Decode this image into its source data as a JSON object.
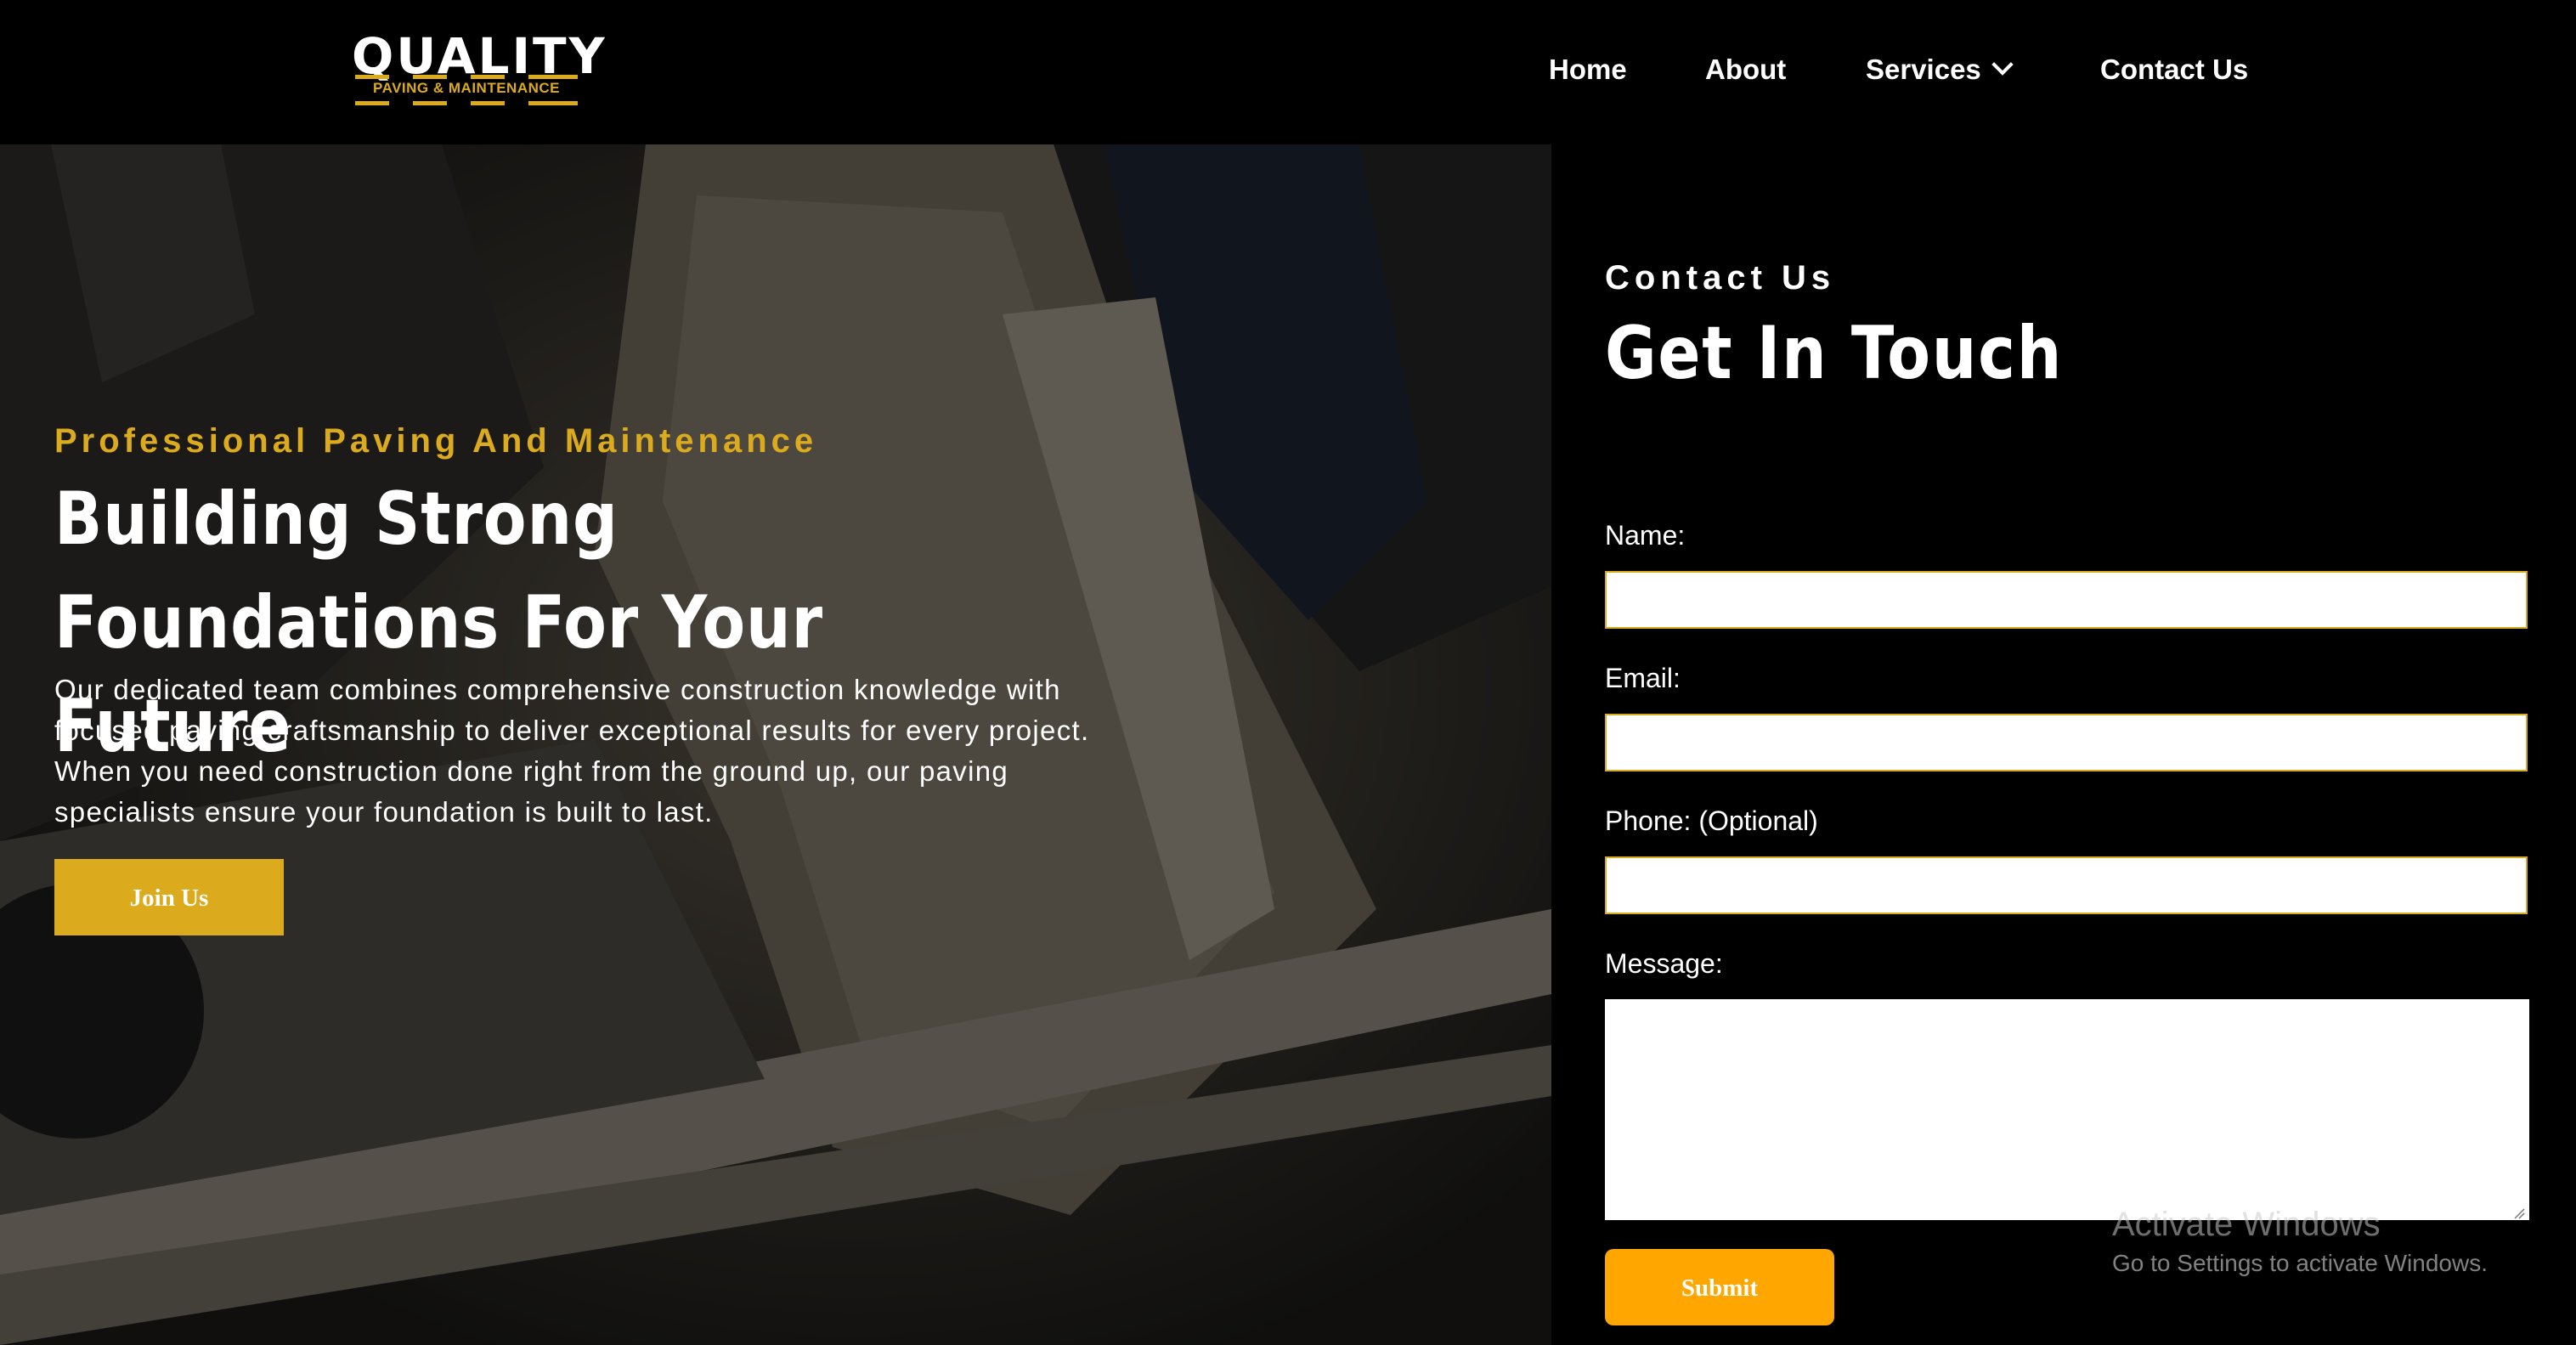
{
  "brand": {
    "logo_word": "QUALITY",
    "logo_tagline": "PAVING & MAINTENANCE",
    "accent_color": "#dcab1d"
  },
  "nav": {
    "items": [
      {
        "label": "Home"
      },
      {
        "label": "About"
      },
      {
        "label": "Services",
        "has_dropdown": true
      },
      {
        "label": "Contact Us"
      }
    ]
  },
  "hero": {
    "eyebrow": "Professional Paving And Maintenance",
    "headline_line1": "Building Strong",
    "headline_line2": "Foundations For Your Future",
    "description_lines": [
      "Our dedicated team combines comprehensive construction knowledge with",
      "focused paving craftsmanship to deliver exceptional results for every project.",
      "When you need construction done right from the ground up, our paving",
      "specialists ensure your foundation is built to last."
    ],
    "cta_label": "Join Us"
  },
  "contact": {
    "eyebrow": "Contact Us",
    "title": "Get In Touch",
    "fields": [
      {
        "label": "Name:",
        "value": ""
      },
      {
        "label": "Email:",
        "value": ""
      },
      {
        "label": "Phone: (Optional)",
        "value": ""
      },
      {
        "label": "Message:",
        "value": ""
      }
    ],
    "submit_label": "Submit",
    "submit_color": "#ffa600"
  },
  "watermark": {
    "title": "Activate Windows",
    "subtitle": "Go to Settings to activate Windows."
  }
}
